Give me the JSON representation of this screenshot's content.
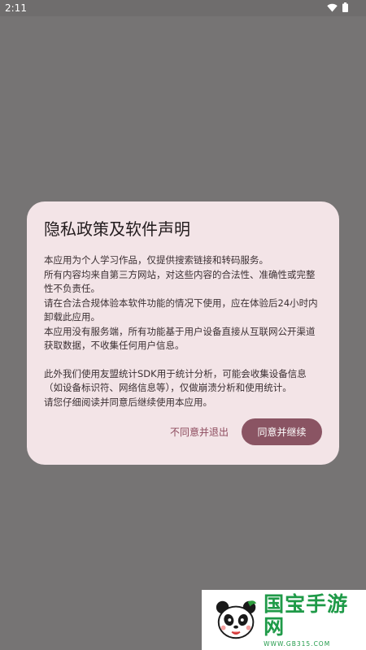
{
  "status_bar": {
    "time": "2:11",
    "icons": [
      "wifi-icon",
      "battery-icon"
    ]
  },
  "dialog": {
    "title": "隐私政策及软件声明",
    "paragraphs": [
      "本应用为个人学习作品，仅提供搜索链接和转码服务。",
      "所有内容均来自第三方网站，对这些内容的合法性、准确性或完整性不负责任。",
      "请在合法合规体验本软件功能的情况下使用，应在体验后24小时内卸载此应用。",
      "本应用没有服务端，所有功能基于用户设备直接从互联网公开渠道获取数据，不收集任何用户信息。",
      "",
      "此外我们使用友盟统计SDK用于统计分析，可能会收集设备信息（如设备标识符、网络信息等），仅做崩溃分析和使用统计。",
      "请您仔细阅读并同意后继续使用本应用。"
    ],
    "decline_label": "不同意并退出",
    "accept_label": "同意并继续"
  },
  "watermark": {
    "title": "国宝手游网",
    "url": "WWW.GB315.COM"
  },
  "colors": {
    "scrim": "#767474",
    "dialog_bg": "#f3e4e7",
    "accent": "#8a5463",
    "decline_text": "#8c4a5d",
    "watermark_green": "#1f9a48"
  }
}
